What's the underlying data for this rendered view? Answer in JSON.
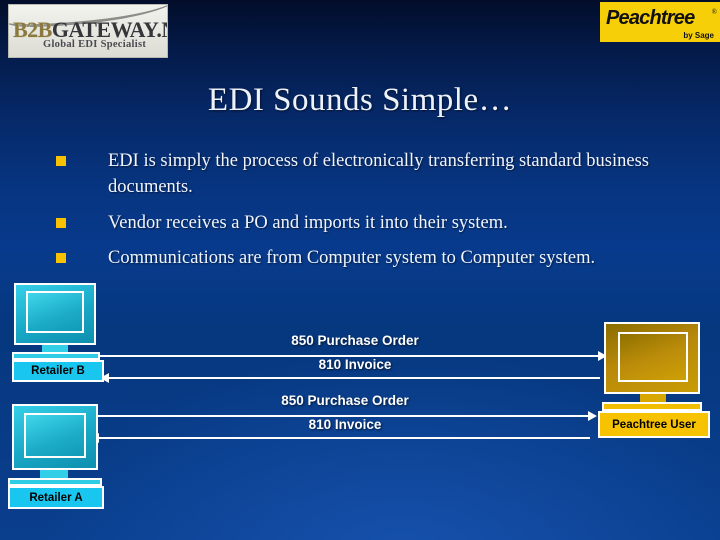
{
  "header": {
    "b2b_logo": {
      "name": "b2bgateway-net-logo",
      "main_prefix": "B2B",
      "main_suffix": "GATEWAY.NET",
      "subtitle": "Global EDI Specialist"
    },
    "peachtree_logo": {
      "name": "peachtree-by-sage-logo",
      "brand": "Peachtree",
      "trademark": "®",
      "byline": "by Sage",
      "background_color": "#f6cf08",
      "text_color": "#111111"
    }
  },
  "slide": {
    "title": "EDI Sounds Simple…",
    "background_top_color": "#020d2a",
    "background_bottom_color": "#0a3f8e",
    "bullet_marker_color": "#f8c200",
    "bullets": [
      "EDI is simply the process of electronically transferring standard business documents.",
      "Vendor receives a PO and imports it into their system.",
      "Communications are from Computer system to Computer system."
    ]
  },
  "diagram": {
    "nodes": [
      {
        "id": "retailer-b",
        "label": "Retailer B",
        "color": "#19c6ef",
        "type": "computer"
      },
      {
        "id": "retailer-a",
        "label": "Retailer A",
        "color": "#19c6ef",
        "type": "computer"
      },
      {
        "id": "peachtree-user",
        "label": "Peachtree User",
        "color": "#f7c200",
        "type": "computer"
      }
    ],
    "flows": [
      {
        "id": "flow-top",
        "from": "retailer-b",
        "to": "peachtree-user",
        "outbound_label": "850 Purchase Order",
        "inbound_label": "810 Invoice"
      },
      {
        "id": "flow-bottom",
        "from": "retailer-a",
        "to": "peachtree-user",
        "outbound_label": "850 Purchase Order",
        "inbound_label": "810 Invoice"
      }
    ],
    "arrow_color": "#ffffff"
  }
}
